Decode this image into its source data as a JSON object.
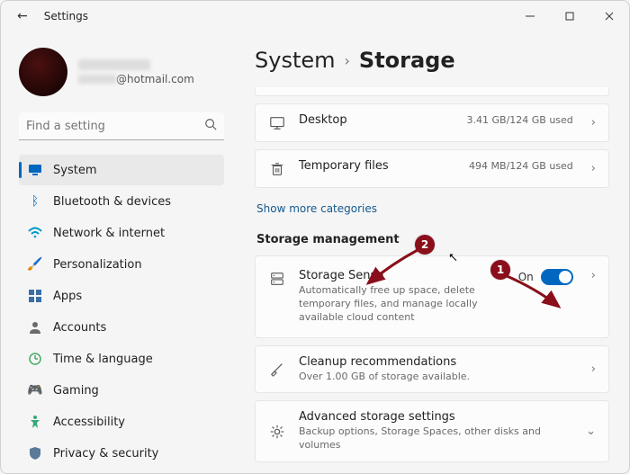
{
  "window": {
    "title": "Settings"
  },
  "profile": {
    "email_suffix": "@hotmail.com"
  },
  "search": {
    "placeholder": "Find a setting"
  },
  "nav": [
    {
      "label": "System",
      "icon": "monitor",
      "active": true
    },
    {
      "label": "Bluetooth & devices",
      "icon": "bluetooth"
    },
    {
      "label": "Network & internet",
      "icon": "wifi"
    },
    {
      "label": "Personalization",
      "icon": "brush"
    },
    {
      "label": "Apps",
      "icon": "apps"
    },
    {
      "label": "Accounts",
      "icon": "person"
    },
    {
      "label": "Time & language",
      "icon": "clock"
    },
    {
      "label": "Gaming",
      "icon": "gamepad"
    },
    {
      "label": "Accessibility",
      "icon": "accessibility"
    },
    {
      "label": "Privacy & security",
      "icon": "shield"
    }
  ],
  "breadcrumb": {
    "parent": "System",
    "current": "Storage"
  },
  "storage_items": [
    {
      "title": "Desktop",
      "usage": "3.41 GB/124 GB used",
      "fill_pct": 3
    },
    {
      "title": "Temporary files",
      "usage": "494 MB/124 GB used",
      "fill_pct": 1
    }
  ],
  "show_more": "Show more categories",
  "section": "Storage management",
  "storage_sense": {
    "title": "Storage Sense",
    "desc": "Automatically free up space, delete temporary files, and manage locally available cloud content",
    "toggle_label": "On",
    "toggle_on": true
  },
  "cleanup": {
    "title": "Cleanup recommendations",
    "desc": "Over 1.00 GB of storage available."
  },
  "advanced": {
    "title": "Advanced storage settings",
    "desc": "Backup options, Storage Spaces, other disks and volumes"
  },
  "annotations": {
    "marker1": "1",
    "marker2": "2"
  }
}
